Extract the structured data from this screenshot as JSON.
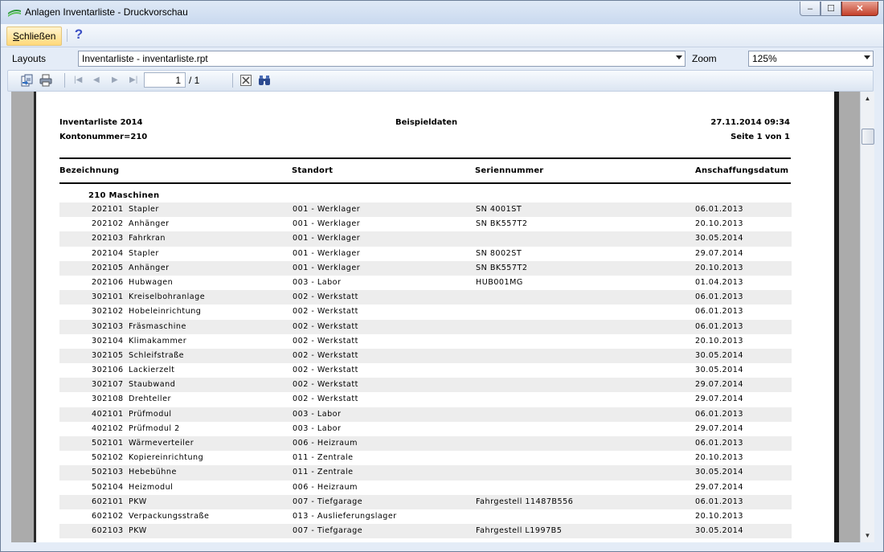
{
  "window": {
    "title": "Anlagen Inventarliste - Druckvorschau",
    "controls": {
      "minimize": "‒",
      "maximize": "☐",
      "close": "✕"
    }
  },
  "menubar": {
    "close_label_first": "S",
    "close_label_rest": "chließen",
    "help_icon": "?"
  },
  "layouts": {
    "label": "Layouts",
    "selected": "Inventarliste - inventarliste.rpt",
    "zoom_label": "Zoom",
    "zoom_selected": "125%"
  },
  "toolbar": {
    "icons": [
      "export-icon",
      "print-icon",
      "first-page-icon",
      "prev-page-icon",
      "next-page-icon",
      "last-page-icon",
      "close-preview-icon",
      "search-icon"
    ],
    "page_current": "1",
    "page_total": "/ 1"
  },
  "report": {
    "title": "Inventarliste 2014",
    "subtitle": "Kontonummer=210",
    "center": "Beispieldaten",
    "datetime": "27.11.2014 09:34",
    "page_info": "Seite 1 von 1",
    "columns": [
      "Bezeichnung",
      "Standort",
      "Seriennummer",
      "Anschaffungsdatum"
    ],
    "group": "210   Maschinen",
    "rows": [
      {
        "nr": "202101",
        "bez": "Stapler",
        "sto": "001 - Werklager",
        "ser": "SN 4001ST",
        "dat": "06.01.2013"
      },
      {
        "nr": "202102",
        "bez": "Anhänger",
        "sto": "001 - Werklager",
        "ser": "SN BK557T2",
        "dat": "20.10.2013"
      },
      {
        "nr": "202103",
        "bez": "Fahrkran",
        "sto": "001 - Werklager",
        "ser": "",
        "dat": "30.05.2014"
      },
      {
        "nr": "202104",
        "bez": "Stapler",
        "sto": "001 - Werklager",
        "ser": "SN 8002ST",
        "dat": "29.07.2014"
      },
      {
        "nr": "202105",
        "bez": "Anhänger",
        "sto": "001 - Werklager",
        "ser": "SN BK557T2",
        "dat": "20.10.2013"
      },
      {
        "nr": "202106",
        "bez": "Hubwagen",
        "sto": "003 - Labor",
        "ser": "HUB001MG",
        "dat": "01.04.2013"
      },
      {
        "nr": "302101",
        "bez": "Kreiselbohranlage",
        "sto": "002 - Werkstatt",
        "ser": "",
        "dat": "06.01.2013"
      },
      {
        "nr": "302102",
        "bez": "Hobeleinrichtung",
        "sto": "002 - Werkstatt",
        "ser": "",
        "dat": "06.01.2013"
      },
      {
        "nr": "302103",
        "bez": "Fräsmaschine",
        "sto": "002 - Werkstatt",
        "ser": "",
        "dat": "06.01.2013"
      },
      {
        "nr": "302104",
        "bez": "Klimakammer",
        "sto": "002 - Werkstatt",
        "ser": "",
        "dat": "20.10.2013"
      },
      {
        "nr": "302105",
        "bez": "Schleifstraße",
        "sto": "002 - Werkstatt",
        "ser": "",
        "dat": "30.05.2014"
      },
      {
        "nr": "302106",
        "bez": "Lackierzelt",
        "sto": "002 - Werkstatt",
        "ser": "",
        "dat": "30.05.2014"
      },
      {
        "nr": "302107",
        "bez": "Staubwand",
        "sto": "002 - Werkstatt",
        "ser": "",
        "dat": "29.07.2014"
      },
      {
        "nr": "302108",
        "bez": "Drehteller",
        "sto": "002 - Werkstatt",
        "ser": "",
        "dat": "29.07.2014"
      },
      {
        "nr": "402101",
        "bez": "Prüfmodul",
        "sto": "003 - Labor",
        "ser": "",
        "dat": "06.01.2013"
      },
      {
        "nr": "402102",
        "bez": "Prüfmodul 2",
        "sto": "003 - Labor",
        "ser": "",
        "dat": "29.07.2014"
      },
      {
        "nr": "502101",
        "bez": "Wärmeverteiler",
        "sto": "006 - Heizraum",
        "ser": "",
        "dat": "06.01.2013"
      },
      {
        "nr": "502102",
        "bez": "Kopiereinrichtung",
        "sto": "011 - Zentrale",
        "ser": "",
        "dat": "20.10.2013"
      },
      {
        "nr": "502103",
        "bez": "Hebebühne",
        "sto": "011 - Zentrale",
        "ser": "",
        "dat": "30.05.2014"
      },
      {
        "nr": "502104",
        "bez": "Heizmodul",
        "sto": "006 - Heizraum",
        "ser": "",
        "dat": "29.07.2014"
      },
      {
        "nr": "602101",
        "bez": "PKW",
        "sto": "007 - Tiefgarage",
        "ser": "Fahrgestell 11487B556",
        "dat": "06.01.2013"
      },
      {
        "nr": "602102",
        "bez": "Verpackungsstraße",
        "sto": "013 - Auslieferungslager",
        "ser": "",
        "dat": "20.10.2013"
      },
      {
        "nr": "602103",
        "bez": "PKW",
        "sto": "007 - Tiefgarage",
        "ser": "Fahrgestell L1997B5",
        "dat": "30.05.2014"
      }
    ]
  }
}
